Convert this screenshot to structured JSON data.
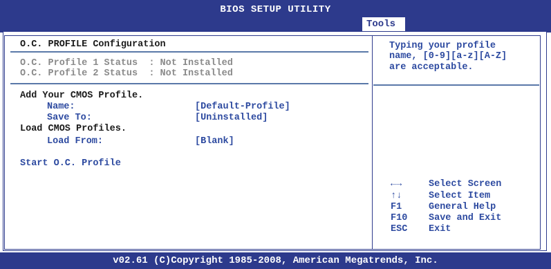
{
  "header": {
    "title": "BIOS SETUP UTILITY",
    "active_tab": "Tools"
  },
  "main": {
    "section_title": "O.C. PROFILE Configuration",
    "status_lines": [
      "O.C. Profile 1 Status  : Not Installed",
      "O.C. Profile 2 Status  : Not Installed"
    ],
    "add_heading": "Add Your CMOS Profile.",
    "name_label": "Name:",
    "name_value": "[Default-Profile]",
    "save_label": "Save To:",
    "save_value": "[Uninstalled]",
    "load_heading": "Load CMOS Profiles.",
    "load_label": "Load From:",
    "load_value": "[Blank]",
    "start_label": "Start O.C. Profile"
  },
  "help": {
    "lines": [
      "Typing your profile",
      "name, [0-9][a-z][A-Z]",
      "are acceptable."
    ],
    "keys": [
      {
        "key": "←→",
        "action": "Select Screen"
      },
      {
        "key": "↑↓",
        "action": "Select Item"
      },
      {
        "key": "F1",
        "action": "General Help"
      },
      {
        "key": "F10",
        "action": "Save and Exit"
      },
      {
        "key": "ESC",
        "action": "Exit"
      }
    ]
  },
  "footer": {
    "copyright": "v02.61 (C)Copyright 1985-2008, American Megatrends, Inc."
  },
  "colors": {
    "bar": "#2d3a8c",
    "option": "#2d4aa0",
    "disabled": "#8a8a8a"
  }
}
